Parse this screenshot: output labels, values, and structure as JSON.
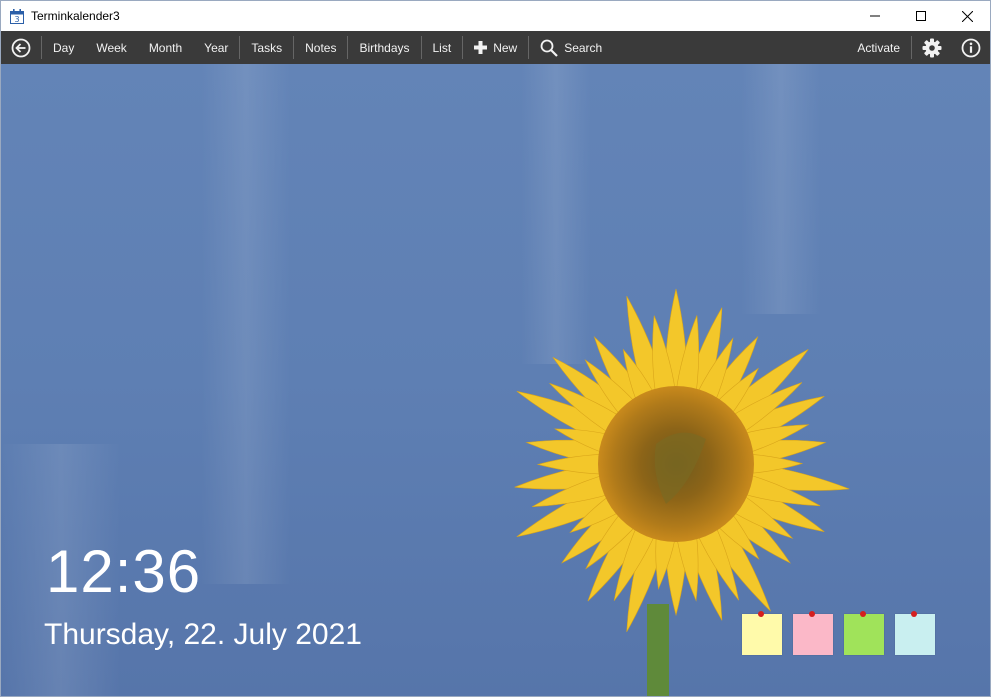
{
  "window": {
    "title": "Terminkalender3",
    "icon_day": "3"
  },
  "toolbar": {
    "back": "back-arrow-icon",
    "items": [
      "Day",
      "Week",
      "Month",
      "Year",
      "Tasks",
      "Notes",
      "Birthdays",
      "List"
    ],
    "new_label": "New",
    "search_label": "Search",
    "activate_label": "Activate"
  },
  "home": {
    "time": "12:36",
    "date": "Thursday, 22. July 2021"
  },
  "notes": [
    {
      "color": "#fffaaa"
    },
    {
      "color": "#fbb8c8"
    },
    {
      "color": "#a0e35a"
    },
    {
      "color": "#c9eff0"
    }
  ],
  "colors": {
    "sky": "#5b7db0",
    "toolbar": "#3a3a3a",
    "petal": "#f3c72a",
    "center": "#8a5a16"
  }
}
